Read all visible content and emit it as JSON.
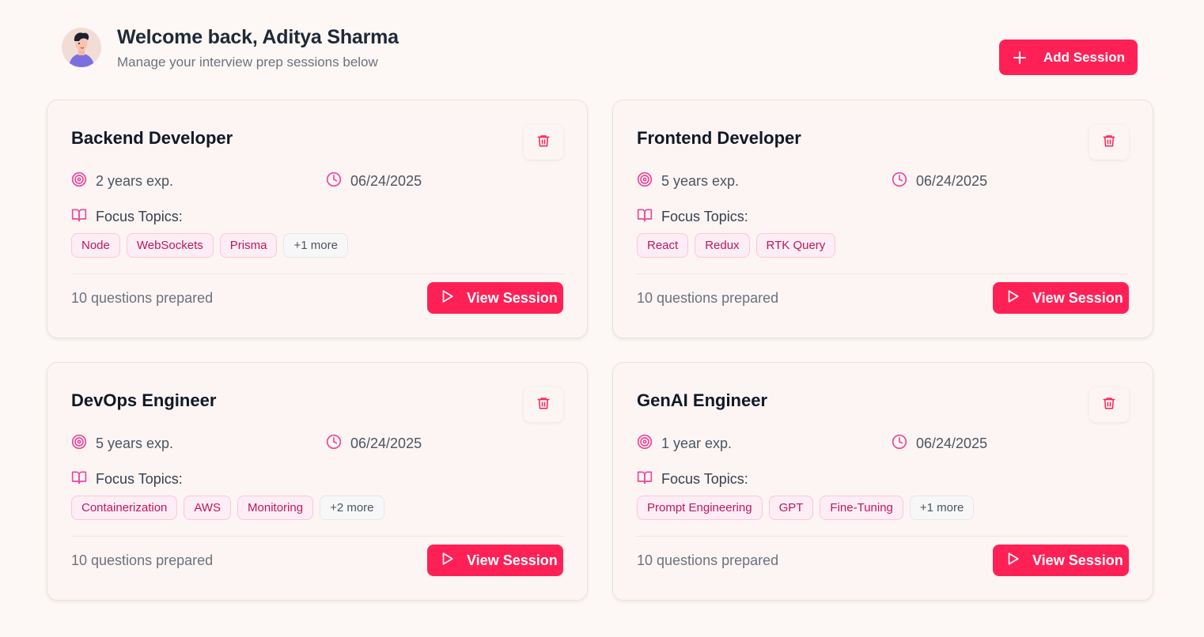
{
  "header": {
    "welcome": "Welcome back, Aditya Sharma",
    "subtitle": "Manage your interview prep sessions below",
    "add_label": "Add Session"
  },
  "colors": {
    "accent": "#ff2156",
    "tag_text": "#be185d",
    "icon_pink": "#ec4899"
  },
  "icons": {
    "add": "plus-icon",
    "delete": "trash-icon",
    "experience": "target-icon",
    "date": "clock-icon",
    "topics": "book-open-icon",
    "view": "play-icon"
  },
  "cards": [
    {
      "title": "Backend Developer",
      "experience": "2 years exp.",
      "date": "06/24/2025",
      "focus_label": "Focus Topics:",
      "tags": [
        "Node",
        "WebSockets",
        "Prisma"
      ],
      "more": "+1 more",
      "questions": "10 questions prepared",
      "view_label": "View Session"
    },
    {
      "title": "Frontend Developer",
      "experience": "5 years exp.",
      "date": "06/24/2025",
      "focus_label": "Focus Topics:",
      "tags": [
        "React",
        "Redux",
        "RTK Query"
      ],
      "more": "",
      "questions": "10 questions prepared",
      "view_label": "View Session"
    },
    {
      "title": "DevOps Engineer",
      "experience": "5 years exp.",
      "date": "06/24/2025",
      "focus_label": "Focus Topics:",
      "tags": [
        "Containerization",
        "AWS",
        "Monitoring"
      ],
      "more": "+2 more",
      "questions": "10 questions prepared",
      "view_label": "View Session"
    },
    {
      "title": "GenAI Engineer",
      "experience": "1 year exp.",
      "date": "06/24/2025",
      "focus_label": "Focus Topics:",
      "tags": [
        "Prompt Engineering",
        "GPT",
        "Fine-Tuning"
      ],
      "more": "+1 more",
      "questions": "10 questions prepared",
      "view_label": "View Session"
    }
  ]
}
